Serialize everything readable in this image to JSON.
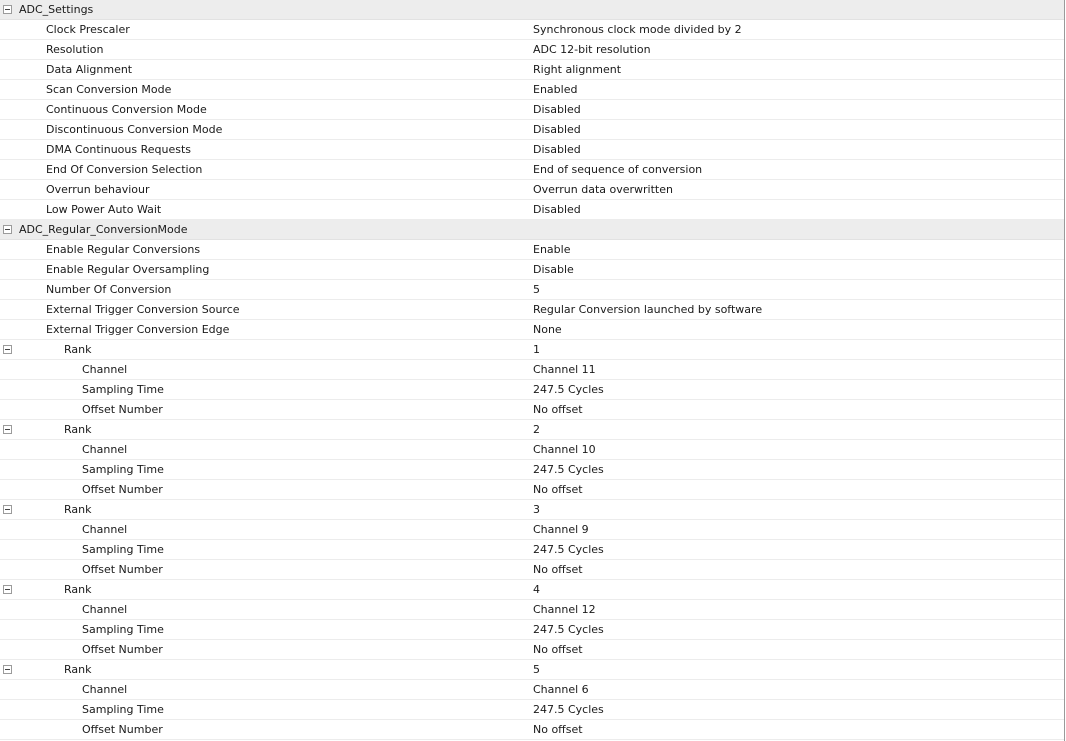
{
  "rows": [
    {
      "level": 0,
      "toggle": true,
      "section": true,
      "name": "ADC_Settings",
      "value": ""
    },
    {
      "level": 1,
      "name": "Clock Prescaler",
      "value": "Synchronous clock mode divided by 2"
    },
    {
      "level": 1,
      "name": "Resolution",
      "value": "ADC 12-bit resolution"
    },
    {
      "level": 1,
      "name": "Data Alignment",
      "value": "Right alignment"
    },
    {
      "level": 1,
      "name": "Scan Conversion Mode",
      "value": "Enabled"
    },
    {
      "level": 1,
      "name": "Continuous Conversion Mode",
      "value": "Disabled"
    },
    {
      "level": 1,
      "name": "Discontinuous Conversion Mode",
      "value": "Disabled"
    },
    {
      "level": 1,
      "name": "DMA Continuous Requests",
      "value": "Disabled"
    },
    {
      "level": 1,
      "name": "End Of Conversion Selection",
      "value": "End of sequence of conversion"
    },
    {
      "level": 1,
      "name": "Overrun behaviour",
      "value": "Overrun data overwritten"
    },
    {
      "level": 1,
      "name": "Low Power Auto Wait",
      "value": "Disabled"
    },
    {
      "level": 0,
      "toggle": true,
      "section": true,
      "name": "ADC_Regular_ConversionMode",
      "value": ""
    },
    {
      "level": 1,
      "name": "Enable Regular Conversions",
      "value": "Enable"
    },
    {
      "level": 1,
      "name": "Enable Regular Oversampling",
      "value": "Disable"
    },
    {
      "level": 1,
      "name": "Number Of Conversion",
      "value": "5"
    },
    {
      "level": 1,
      "name": "External Trigger Conversion Source",
      "value": "Regular Conversion launched by software"
    },
    {
      "level": 1,
      "name": "External Trigger Conversion Edge",
      "value": "None"
    },
    {
      "level": 2,
      "toggle": true,
      "name": "Rank",
      "value": "1"
    },
    {
      "level": 3,
      "name": "Channel",
      "value": "Channel 11"
    },
    {
      "level": 3,
      "name": "Sampling Time",
      "value": "247.5 Cycles"
    },
    {
      "level": 3,
      "name": "Offset Number",
      "value": "No offset"
    },
    {
      "level": 2,
      "toggle": true,
      "name": "Rank",
      "value": "2"
    },
    {
      "level": 3,
      "name": "Channel",
      "value": "Channel 10"
    },
    {
      "level": 3,
      "name": "Sampling Time",
      "value": "247.5 Cycles"
    },
    {
      "level": 3,
      "name": "Offset Number",
      "value": "No offset"
    },
    {
      "level": 2,
      "toggle": true,
      "name": "Rank",
      "value": "3"
    },
    {
      "level": 3,
      "name": "Channel",
      "value": "Channel 9"
    },
    {
      "level": 3,
      "name": "Sampling Time",
      "value": "247.5 Cycles"
    },
    {
      "level": 3,
      "name": "Offset Number",
      "value": "No offset"
    },
    {
      "level": 2,
      "toggle": true,
      "name": "Rank",
      "value": "4"
    },
    {
      "level": 3,
      "name": "Channel",
      "value": "Channel 12"
    },
    {
      "level": 3,
      "name": "Sampling Time",
      "value": "247.5 Cycles"
    },
    {
      "level": 3,
      "name": "Offset Number",
      "value": "No offset"
    },
    {
      "level": 2,
      "toggle": true,
      "name": "Rank",
      "value": "5"
    },
    {
      "level": 3,
      "name": "Channel",
      "value": "Channel 6"
    },
    {
      "level": 3,
      "name": "Sampling Time",
      "value": "247.5 Cycles"
    },
    {
      "level": 3,
      "name": "Offset Number",
      "value": "No offset"
    }
  ]
}
